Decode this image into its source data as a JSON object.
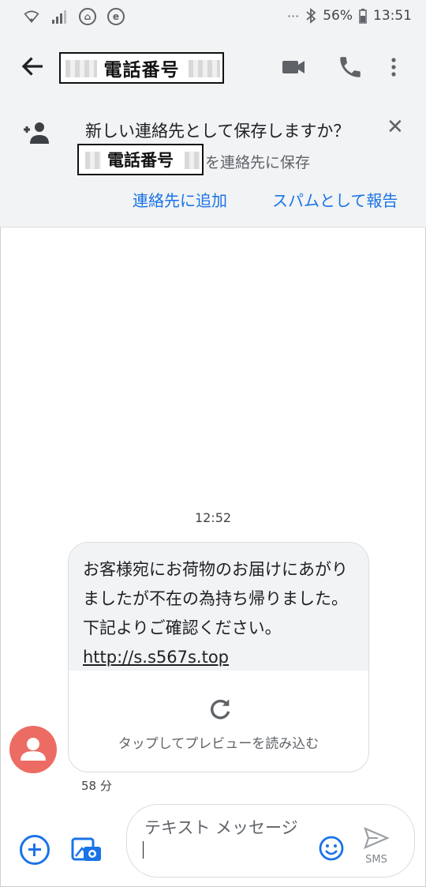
{
  "status_bar": {
    "battery": "56%",
    "time": "13:51",
    "icons": [
      "wifi-icon",
      "signal-icon",
      "notification-badge-icon",
      "app-e-icon",
      "more-dots-icon",
      "bluetooth-icon",
      "battery-icon"
    ]
  },
  "header": {
    "title": "電話番号",
    "icons": [
      "back-arrow-icon",
      "video-call-icon",
      "phone-icon",
      "more-vert-icon"
    ]
  },
  "banner": {
    "question": "新しい連絡先として保存しますか？",
    "number": "電話番号",
    "save_suffix": "を連絡先に保存",
    "add_contact": "連絡先に追加",
    "report_spam": "スパムとして報告"
  },
  "conversation": {
    "timestamp": "12:52",
    "message_text": "お客様宛にお荷物のお届けにあがりましたが不在の為持ち帰りました。 下記よりご確認ください。",
    "message_link": "http://s.s567s.top",
    "preview_label": "タップしてプレビューを読み込む",
    "relative_time": "58 分"
  },
  "composer": {
    "placeholder": "テキスト メッセージ",
    "send_label": "SMS"
  },
  "colors": {
    "accent": "#1a73e8",
    "avatar": "#ec6b63",
    "header_bg": "#f1f3f4"
  }
}
